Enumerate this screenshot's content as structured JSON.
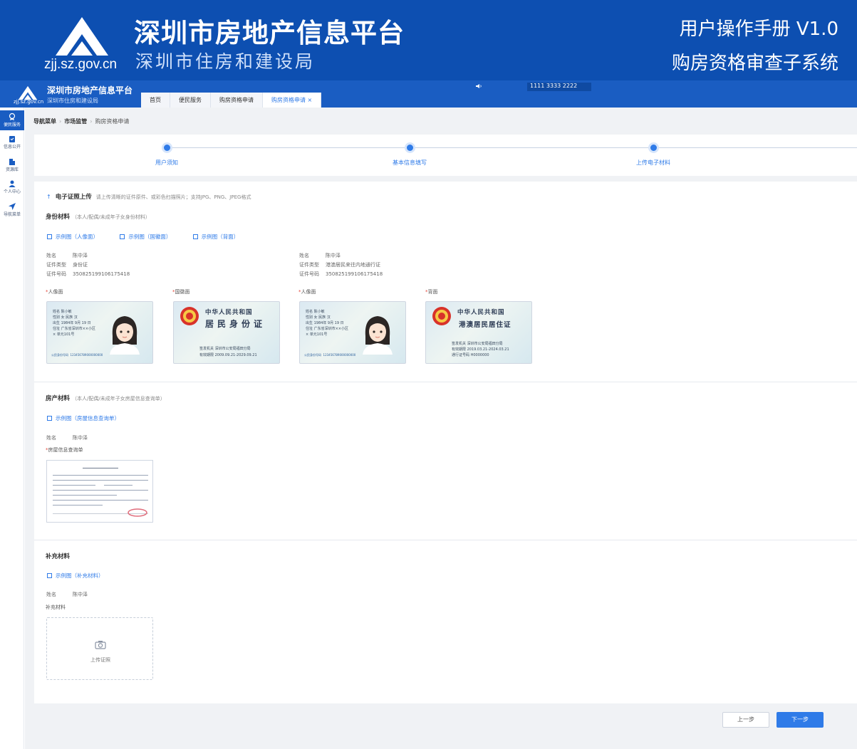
{
  "banner": {
    "logo_url": "zjj.sz.gov.cn",
    "title": "深圳市房地产信息平台",
    "subtitle": "深圳市住房和建设局",
    "manual": "用户操作手册 V1.0",
    "system": "购房资格审查子系统"
  },
  "appbar": {
    "mini_url": "zjj.sz.gov.cn",
    "mini_title": "深圳市房地产信息平台",
    "mini_sub": "深圳市住房和建设局",
    "tabs": [
      {
        "label": "首页"
      },
      {
        "label": "便民服务"
      },
      {
        "label": "购房资格申请"
      },
      {
        "label": "购房资格申请 ×"
      }
    ],
    "notice": "1111  3333  2222"
  },
  "sidebar": {
    "items": [
      {
        "label": "便民服务",
        "icon": "medal-icon"
      },
      {
        "label": "信息公开",
        "icon": "clipboard-icon"
      },
      {
        "label": "资源库",
        "icon": "building-icon"
      },
      {
        "label": "个人中心",
        "icon": "user-icon"
      },
      {
        "label": "导航菜单",
        "icon": "navigation-icon"
      }
    ]
  },
  "breadcrumb": {
    "items": [
      "导航菜单",
      "市场监管",
      "购房资格申请"
    ]
  },
  "steps": [
    {
      "label": "用户须知"
    },
    {
      "label": "基本信息填写"
    },
    {
      "label": "上传电子材料"
    }
  ],
  "upload": {
    "title": "电子证照上传",
    "hint": "请上传清晰的证件原件、或彩色扫描照片；支持JPG、PNG、JPEG格式"
  },
  "identity": {
    "title": "身份材料",
    "note": "（本人/配偶/未成年子女身份材料）",
    "examples": [
      "示例图（人像面）",
      "示例图（国徽面）",
      "示例图（背面）"
    ],
    "persons": [
      {
        "name_label": "姓名",
        "name": "陈中泽",
        "type_label": "证件类型",
        "type": "身份证",
        "no_label": "证件号码",
        "no": "350825199106175418"
      },
      {
        "name_label": "姓名",
        "name": "陈中泽",
        "type_label": "证件类型",
        "type": "港澳居民来往内地通行证",
        "no_label": "证件号码",
        "no": "350825199106175418"
      }
    ],
    "captions": [
      "人像面",
      "国徽面",
      "人像面",
      "背面"
    ],
    "card_texts": {
      "id_front_fields": [
        "姓名  陈小敏",
        "性别  女   民族  汉",
        "出生  1984年 9月 19 日",
        "住址  广东省深圳市××小区",
        "     × 单元101号"
      ],
      "id_number_label": "公民身份号码",
      "id_number": "123456789000000000",
      "id_back_title": "中华人民共和国",
      "id_back_name": "居民身份证",
      "id_back_fields": [
        "签发机关  深圳市公安局福田分局",
        "有效期限  2009.09.21-2029.09.21"
      ],
      "hk_back_title": "中华人民共和国",
      "hk_back_name": "港澳居民居住证",
      "hk_back_fields": [
        "签发机关  深圳市公安局福田分局",
        "有效期限  2019.03.21-2024.03.21",
        "通行证号码  H0000000"
      ]
    }
  },
  "property": {
    "title": "房产材料",
    "note": "（本人/配偶/未成年子女房屋信息查询单）",
    "example": "示例图（房屋信息查询单）",
    "name_label": "姓名",
    "name": "陈中泽",
    "caption": "房屋信息查询单"
  },
  "supplement": {
    "title": "补充材料",
    "example": "示例图（补充材料）",
    "name_label": "姓名",
    "name": "陈中泽",
    "caption": "补充材料",
    "upload_label": "上传证照"
  },
  "buttons": {
    "prev": "上一步",
    "next": "下一步"
  },
  "colors": {
    "banner": "#0d4fb1",
    "appbar": "#1a5dc2",
    "accent": "#2f7be8",
    "required": "#e5483c"
  }
}
